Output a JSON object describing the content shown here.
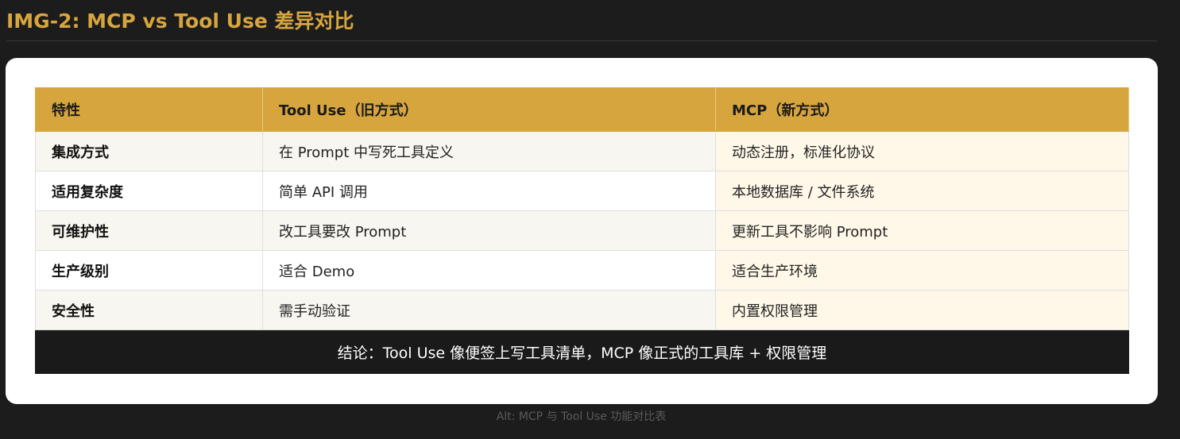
{
  "title": "IMG-2: MCP vs Tool Use 差异对比",
  "table": {
    "headers": [
      "特性",
      "Tool Use（旧方式）",
      "MCP（新方式）"
    ],
    "rows": [
      {
        "feature": "集成方式",
        "tool_use": "在 Prompt 中写死工具定义",
        "mcp": "动态注册，标准化协议"
      },
      {
        "feature": "适用复杂度",
        "tool_use": "简单 API 调用",
        "mcp": "本地数据库 / 文件系统"
      },
      {
        "feature": "可维护性",
        "tool_use": "改工具要改 Prompt",
        "mcp": "更新工具不影响 Prompt"
      },
      {
        "feature": "生产级别",
        "tool_use": "适合 Demo",
        "mcp": "适合生产环境"
      },
      {
        "feature": "安全性",
        "tool_use": "需手动验证",
        "mcp": "内置权限管理"
      }
    ],
    "conclusion": "结论：Tool Use 像便签上写工具清单，MCP 像正式的工具库 + 权限管理"
  },
  "alt_text": "Alt: MCP 与 Tool Use 功能对比表",
  "colors": {
    "accent": "#d6a53e",
    "background": "#1c1c1c",
    "card": "#ffffff",
    "conclusion_bg": "#1a1a1a"
  }
}
